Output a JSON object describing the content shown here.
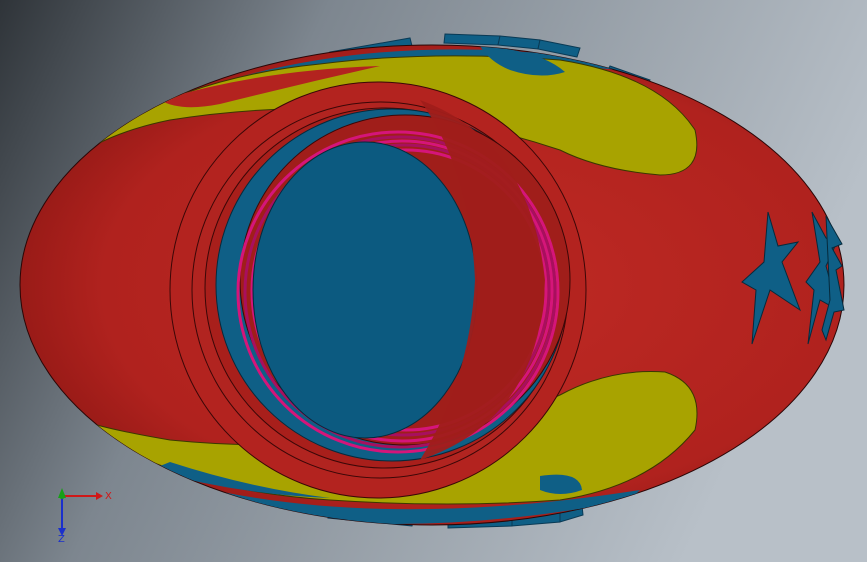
{
  "viewport": {
    "background_top_right": "#a9b2bc",
    "background_left": "#3a3f45",
    "model_colors": {
      "body_red": "#b3231f",
      "body_red_dark": "#8c1714",
      "flame_yellow": "#a8a300",
      "trim_blue": "#0f5f86",
      "spring_pink": "#d5157a"
    }
  },
  "triad": {
    "x_label": "X",
    "z_label": "Z",
    "x_color": "#d01818",
    "y_color": "#17a017",
    "z_color": "#1a2fcc"
  }
}
